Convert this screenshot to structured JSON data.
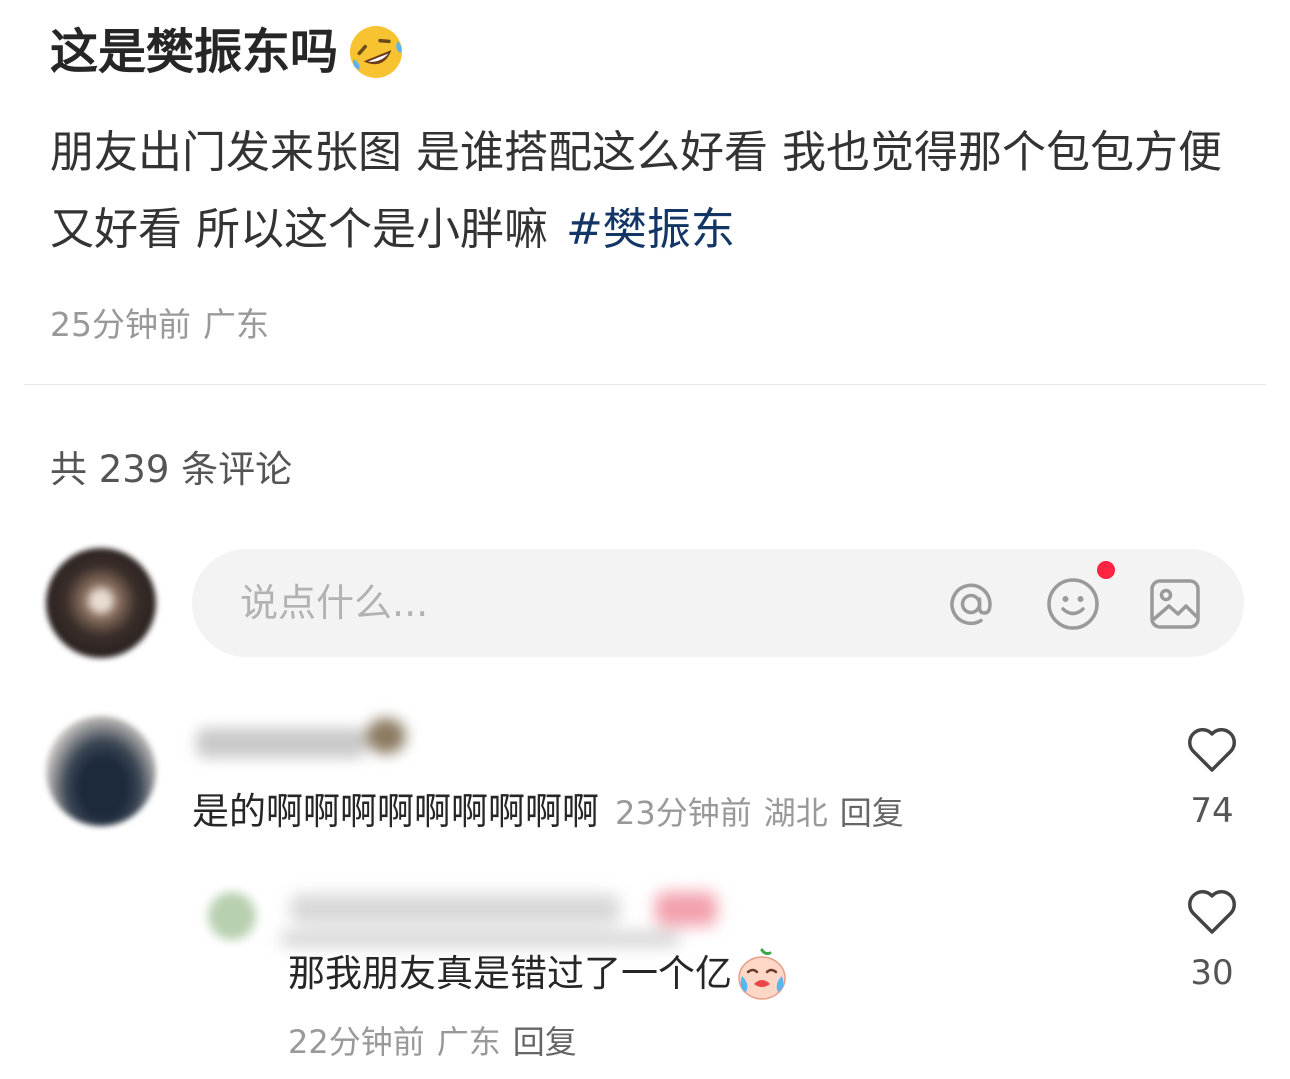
{
  "post": {
    "title": "这是樊振东吗",
    "title_emoji": "rolling-on-floor-laughing-emoji",
    "body_text": "朋友出门发来张图 是谁搭配这么好看 我也觉得那个包包方便又好看 所以这个是小胖嘛",
    "hashtag": "#樊振东",
    "time": "25分钟前",
    "location": "广东"
  },
  "comments_header": {
    "count_text": "共 239 条评论"
  },
  "comment_input": {
    "placeholder": "说点什么...",
    "icons": [
      "at-icon",
      "emoji-icon",
      "image-icon"
    ],
    "notification_dot": true
  },
  "comments": [
    {
      "text": "是的啊啊啊啊啊啊啊啊啊",
      "time": "23分钟前",
      "location": "湖北",
      "reply_label": "回复",
      "likes": "74"
    },
    {
      "text": "那我朋友真是错过了一个亿",
      "emoji": "crying-emoji",
      "time": "22分钟前",
      "location": "广东",
      "reply_label": "回复",
      "likes": "30"
    }
  ],
  "colors": {
    "hashtag": "#133667",
    "meta_gray": "#999999",
    "notification_dot": "#ff2442",
    "input_bg": "#f3f3f3"
  }
}
